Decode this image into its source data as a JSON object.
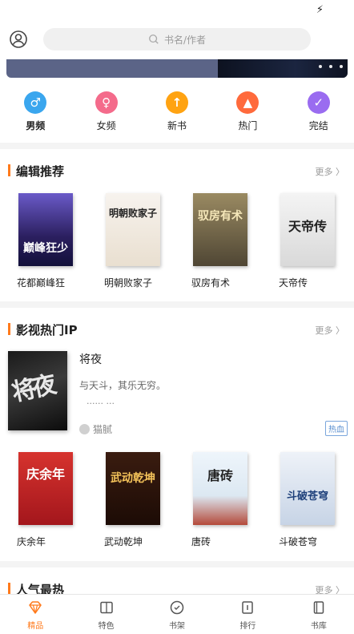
{
  "status": {
    "bolt": "⚡"
  },
  "search": {
    "placeholder": "书名/作者"
  },
  "categories": [
    {
      "label": "男频",
      "color": "#3aa6ee",
      "icon": "male-icon",
      "glyph": "♂"
    },
    {
      "label": "女频",
      "color": "#f46b8b",
      "icon": "female-icon",
      "glyph": "♀"
    },
    {
      "label": "新书",
      "color": "#ffa312",
      "icon": "new-book-icon",
      "glyph": "↑"
    },
    {
      "label": "热门",
      "color": "#ff6a3c",
      "icon": "fire-icon",
      "glyph": "▲"
    },
    {
      "label": "完结",
      "color": "#9a6cf0",
      "icon": "complete-icon",
      "glyph": "✓"
    }
  ],
  "editor_picks": {
    "title": "编辑推荐",
    "more": "更多",
    "books": [
      {
        "name": "花都巅峰狂",
        "cover_text": "巅峰狂少",
        "bg": "#2b1f5f",
        "fg": "#ffffff"
      },
      {
        "name": "明朝败家子",
        "cover_text": "明朝败家子",
        "bg": "#f3eee6",
        "fg": "#222222"
      },
      {
        "name": "驭房有术",
        "cover_text": "驭房有术",
        "bg": "#7a6a4c",
        "fg": "#f5e7b9"
      },
      {
        "name": "天帝传",
        "cover_text": "天帝传",
        "bg": "#eeeeee",
        "fg": "#222222"
      }
    ]
  },
  "film_ip": {
    "title": "影视热门IP",
    "more": "更多",
    "feature": {
      "title": "将夜",
      "desc": "与天斗，其乐无穷。",
      "desc2": "...... ...",
      "author": "猫腻",
      "tag": "热血",
      "cover_text": "将夜"
    },
    "books": [
      {
        "name": "庆余年",
        "cover_text": "庆余年",
        "bg": "#c9242a",
        "fg": "#ffffff"
      },
      {
        "name": "武动乾坤",
        "cover_text": "武动乾坤",
        "bg": "#2a130c",
        "fg": "#f4c35a"
      },
      {
        "name": "唐砖",
        "cover_text": "唐砖",
        "bg": "#eaf2f8",
        "fg": "#222222"
      },
      {
        "name": "斗破苍穹",
        "cover_text": "斗破苍穹",
        "bg": "#dde5f0",
        "fg": "#1d3f7a"
      }
    ]
  },
  "popular": {
    "title": "人气最热",
    "more": "更多"
  },
  "tabs": [
    {
      "label": "精品",
      "icon": "diamond-icon",
      "active": true
    },
    {
      "label": "特色",
      "icon": "book-open-icon",
      "active": false
    },
    {
      "label": "书架",
      "icon": "bookshelf-icon",
      "active": false
    },
    {
      "label": "排行",
      "icon": "ranking-icon",
      "active": false
    },
    {
      "label": "书库",
      "icon": "library-icon",
      "active": false
    }
  ]
}
